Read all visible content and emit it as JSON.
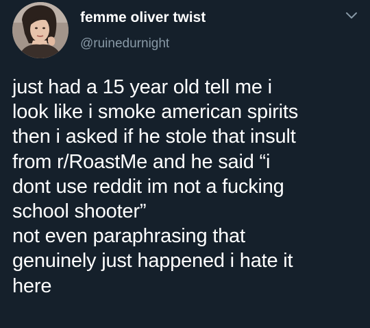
{
  "tweet": {
    "display_name": "femme oliver twist",
    "handle": "@ruinedurnight",
    "text_lines": [
      "just had a 15 year old tell me i",
      "look like i smoke american spirits",
      "then i asked if he stole that insult",
      "from r/RoastMe and he said “i",
      "dont use reddit im not a fucking",
      "school shooter”",
      "not even paraphrasing that",
      "genuinely just happened i hate it",
      "here"
    ],
    "avatar_icon": "profile-photo",
    "menu_icon": "chevron-down-icon"
  },
  "colors": {
    "background": "#15202b",
    "text": "#ffffff",
    "secondary_text": "#8899a6"
  }
}
